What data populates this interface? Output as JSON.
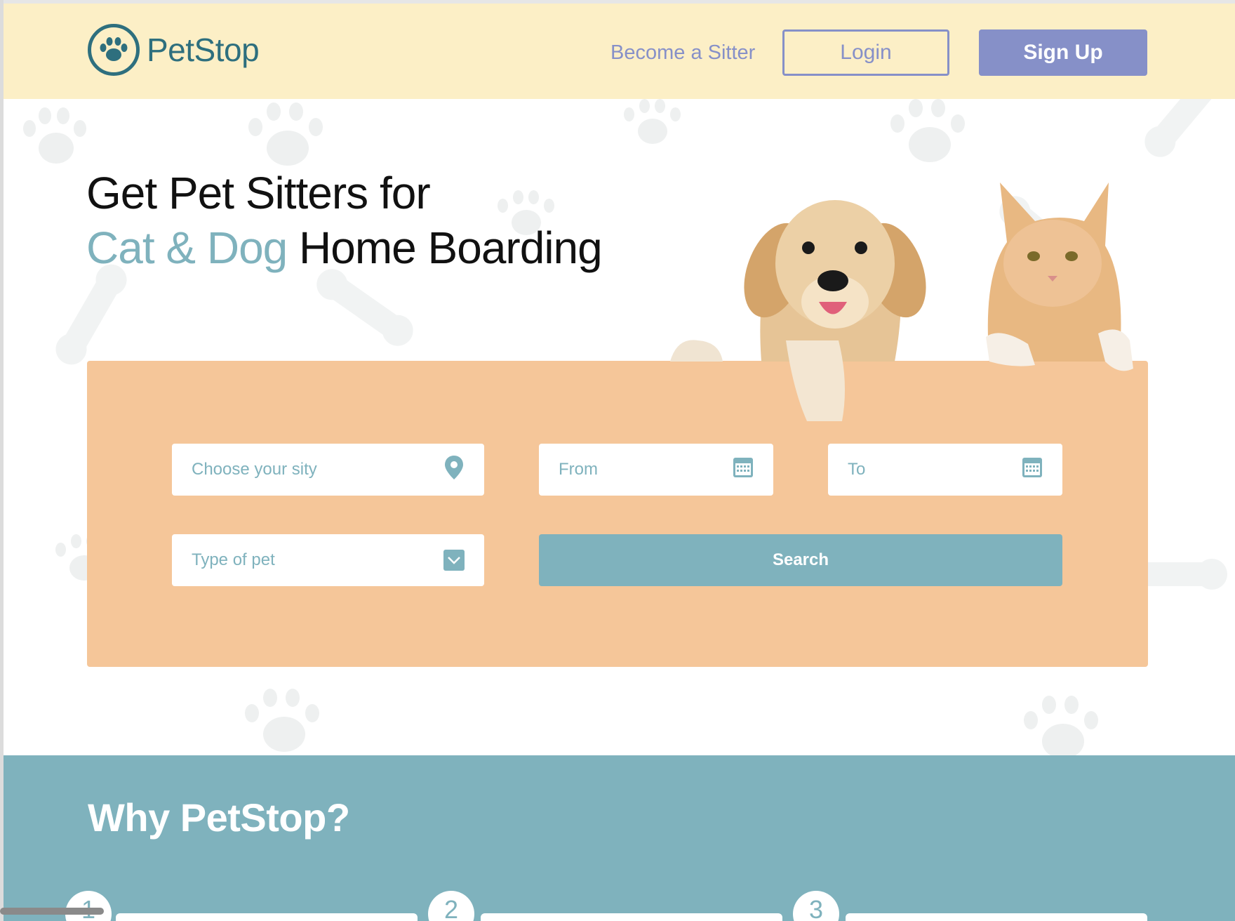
{
  "header": {
    "logo_text": "PetStop",
    "nav_become_sitter": "Become a Sitter",
    "login_label": "Login",
    "signup_label": "Sign Up"
  },
  "hero": {
    "title_line1": "Get Pet Sitters for",
    "title_accent": "Cat & Dog",
    "title_rest": " Home Boarding"
  },
  "search": {
    "city_placeholder": "Choose your sity",
    "from_placeholder": "From",
    "to_placeholder": "To",
    "pet_type_placeholder": "Type of pet",
    "search_label": "Search"
  },
  "why": {
    "title": "Why PetStop?",
    "steps": [
      "1",
      "2",
      "3"
    ]
  },
  "colors": {
    "header_bg": "#fcefc6",
    "brand_teal": "#2e6f7e",
    "accent_teal": "#7fb2bd",
    "periwinkle": "#8690c8",
    "panel_peach": "#f5c699"
  },
  "icons": [
    "paw-logo-icon",
    "location-pin-icon",
    "calendar-icon",
    "chevron-down-icon"
  ]
}
